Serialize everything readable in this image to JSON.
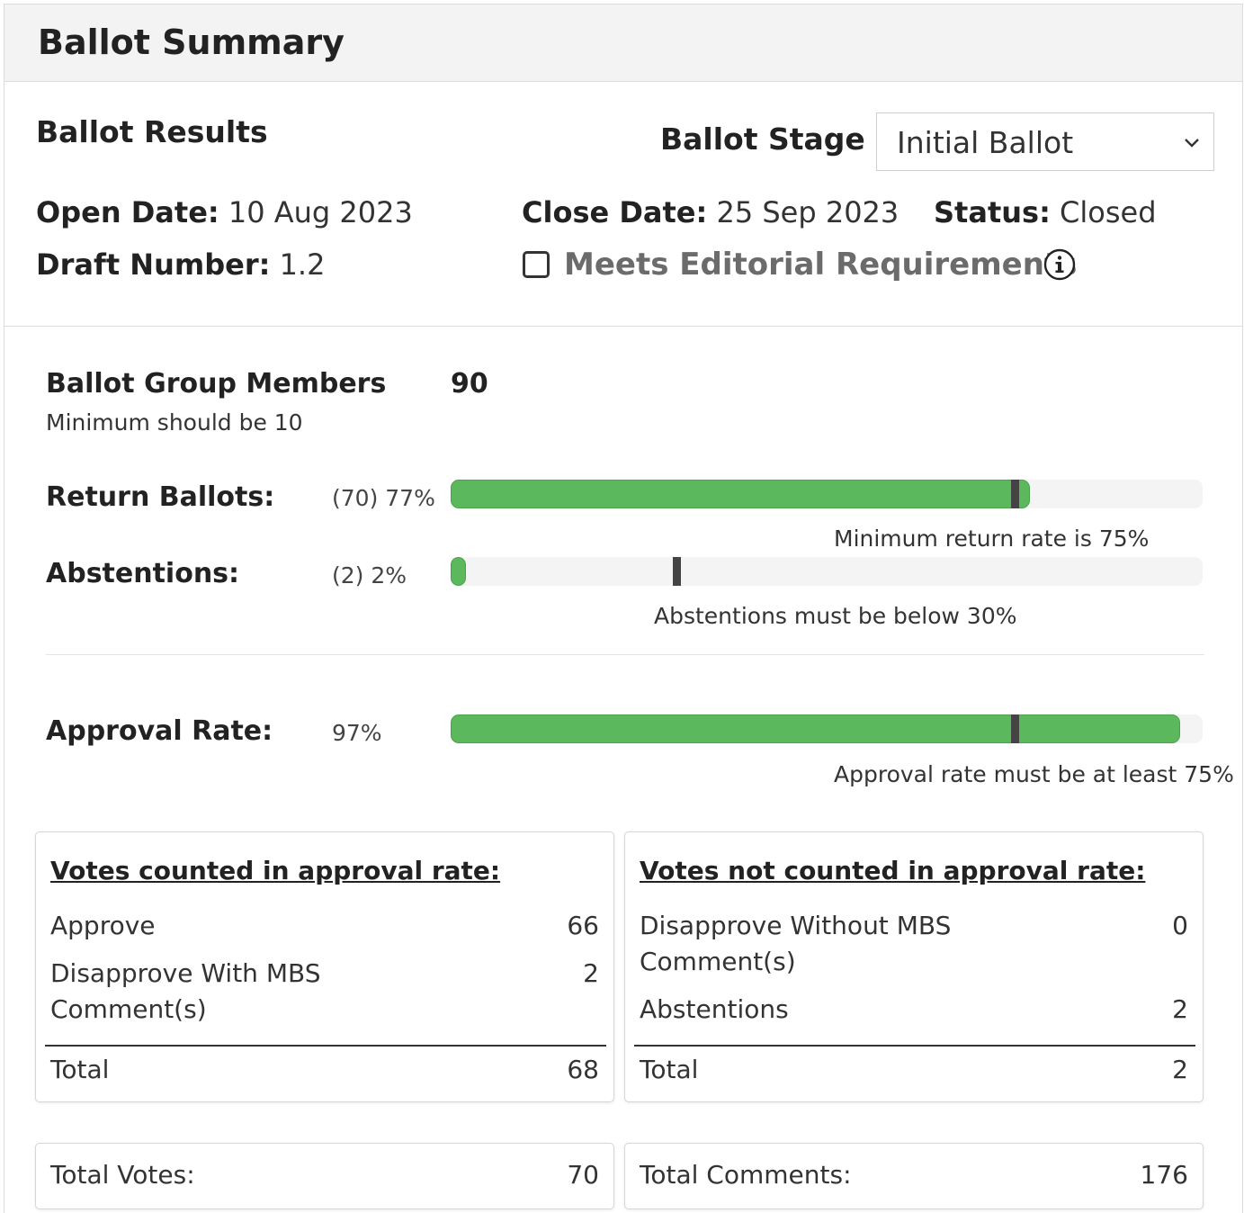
{
  "header": {
    "title": "Ballot Summary"
  },
  "results": {
    "title": "Ballot Results",
    "stage_label": "Ballot Stage",
    "stage_value": "Initial Ballot",
    "open_date_label": "Open Date:",
    "open_date_value": "10 Aug 2023",
    "close_date_label": "Close Date:",
    "close_date_value": "25 Sep 2023",
    "status_label": "Status:",
    "status_value": "Closed",
    "draft_label": "Draft Number:",
    "draft_value": "1.2",
    "editorial_label": "Meets Editorial Requirements",
    "editorial_checked": false
  },
  "members": {
    "label": "Ballot Group Members",
    "value": "90",
    "note": "Minimum should be 10"
  },
  "return_ballots": {
    "label": "Return Ballots:",
    "value_text": "(70) 77%",
    "percent": 77,
    "threshold_percent": 75,
    "note": "Minimum return rate is 75%"
  },
  "abstentions": {
    "label": "Abstentions:",
    "value_text": "(2) 2%",
    "percent": 2,
    "threshold_percent": 30,
    "note": "Abstentions must be below 30%"
  },
  "approval": {
    "label": "Approval Rate:",
    "value_text": "97%",
    "percent": 97,
    "threshold_percent": 75,
    "note": "Approval rate must be at least 75%"
  },
  "counted": {
    "title": "Votes counted in approval rate:",
    "rows": [
      {
        "label": "Approve",
        "value": "66"
      },
      {
        "label": "Disapprove With MBS Comment(s)",
        "value": "2"
      }
    ],
    "total_label": "Total",
    "total_value": "68"
  },
  "not_counted": {
    "title": "Votes not counted in approval rate:",
    "rows": [
      {
        "label": "Disapprove Without MBS Comment(s)",
        "value": "0"
      },
      {
        "label": "Abstentions",
        "value": "2"
      }
    ],
    "total_label": "Total",
    "total_value": "2"
  },
  "totals": {
    "votes_label": "Total Votes:",
    "votes_value": "70",
    "comments_label": "Total Comments:",
    "comments_value": "176"
  },
  "colors": {
    "bar_fill": "#5cb85c",
    "bar_track": "#f4f4f4",
    "marker": "#444444",
    "header_bg": "#f3f3f3"
  }
}
